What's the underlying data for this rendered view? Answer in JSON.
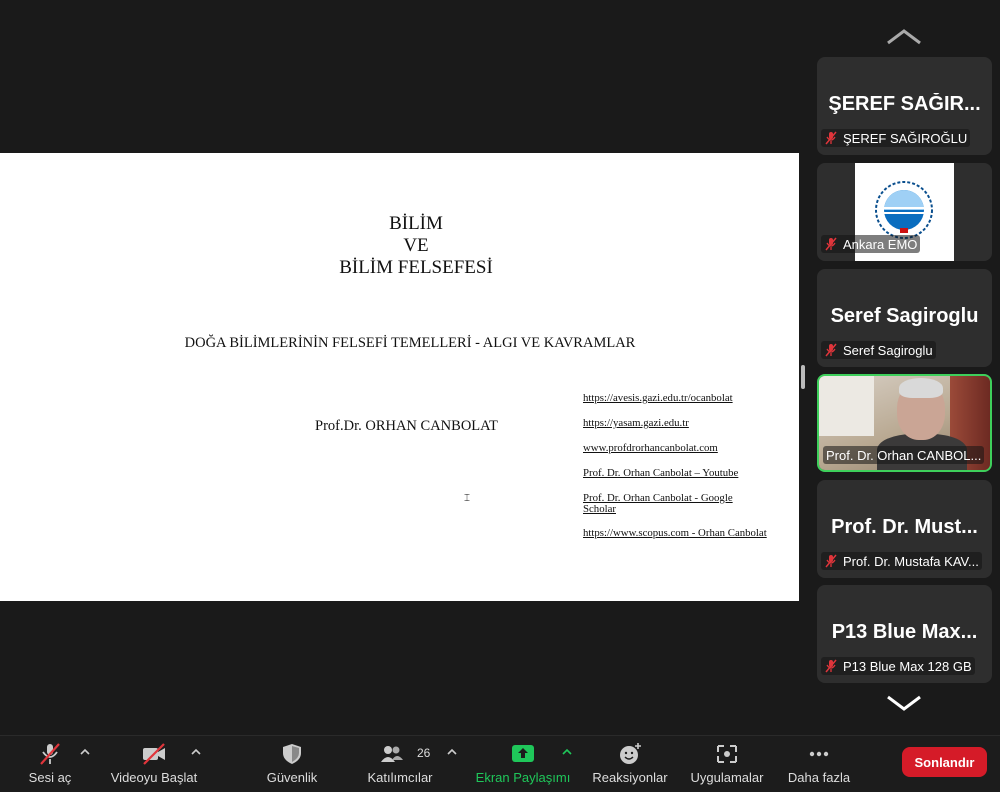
{
  "slide": {
    "title_lines": [
      "BİLİM",
      "VE",
      "BİLİM FELSEFESİ"
    ],
    "subtitle": "DOĞA BİLİMLERİNİN FELSEFİ TEMELLERİ - ALGI VE KAVRAMLAR",
    "author": "Prof.Dr. ORHAN CANBOLAT",
    "links": [
      "https://avesis.gazi.edu.tr/ocanbolat",
      "https://yasam.gazi.edu.tr",
      "www.profdrorhancanbolat.com",
      "Prof. Dr. Orhan Canbolat – Youtube",
      "Prof. Dr. Orhan Canbolat - Google Scholar",
      "https://www.scopus.com - Orhan Canbolat"
    ]
  },
  "participants": [
    {
      "big": "ŞEREF SAĞIR...",
      "label": "ŞEREF SAĞIROĞLU"
    },
    {
      "big": "",
      "label": "Ankara EMO",
      "logo": "EMO"
    },
    {
      "big": "Seref Sagiroglu",
      "label": "Seref Sagiroglu"
    },
    {
      "big": "",
      "label": "Prof. Dr. Orhan CANBOL...",
      "video": true,
      "active": true
    },
    {
      "big": "Prof. Dr. Must...",
      "label": "Prof. Dr. Mustafa KAV..."
    },
    {
      "big": "P13 Blue Max...",
      "label": "P13 Blue Max 128 GB"
    }
  ],
  "toolbar": {
    "unmute": "Sesi aç",
    "start_video": "Videoyu Başlat",
    "security": "Güvenlik",
    "participants": "Katılımcılar",
    "participants_count": "26",
    "share": "Ekran Paylaşımı",
    "reactions": "Reaksiyonlar",
    "apps": "Uygulamalar",
    "more": "Daha fazla",
    "end": "Sonlandır"
  },
  "colors": {
    "end_button": "#d51b28",
    "share_green": "#1fc75a",
    "active_border": "#3ecf5b",
    "muted_red": "#e0353b"
  }
}
